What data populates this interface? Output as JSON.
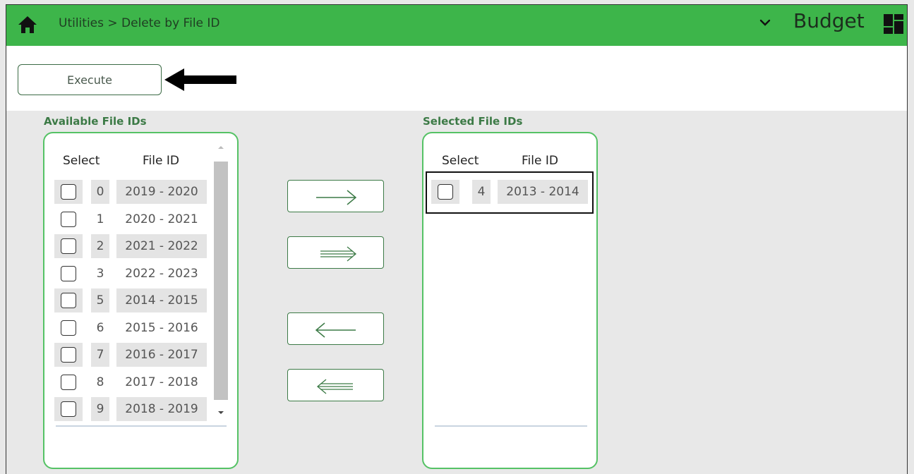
{
  "header": {
    "breadcrumb": "Utilities > Delete by File ID",
    "app_name": "Budget",
    "home_icon": "home-icon",
    "menu_icon": "chevron-down-icon",
    "grid_icon": "grid-icon",
    "bar_color": "#3db54a"
  },
  "toolbar": {
    "execute_label": "Execute"
  },
  "available": {
    "title": "Available File IDs",
    "col_select": "Select",
    "col_file_id": "File ID",
    "rows": [
      {
        "num": "0",
        "file_id": "2019 - 2020"
      },
      {
        "num": "1",
        "file_id": "2020 - 2021"
      },
      {
        "num": "2",
        "file_id": "2021 - 2022"
      },
      {
        "num": "3",
        "file_id": "2022 - 2023"
      },
      {
        "num": "5",
        "file_id": "2014 - 2015"
      },
      {
        "num": "6",
        "file_id": "2015 - 2016"
      },
      {
        "num": "7",
        "file_id": "2016 - 2017"
      },
      {
        "num": "8",
        "file_id": "2017 - 2018"
      },
      {
        "num": "9",
        "file_id": "2018 - 2019"
      }
    ]
  },
  "selected": {
    "title": "Selected File IDs",
    "col_select": "Select",
    "col_file_id": "File ID",
    "rows": [
      {
        "num": "4",
        "file_id": "2013 - 2014"
      }
    ]
  },
  "move_buttons": {
    "add_one": "arrow-right-icon",
    "add_all": "double-arrow-right-icon",
    "remove_one": "arrow-left-icon",
    "remove_all": "double-arrow-left-icon"
  }
}
